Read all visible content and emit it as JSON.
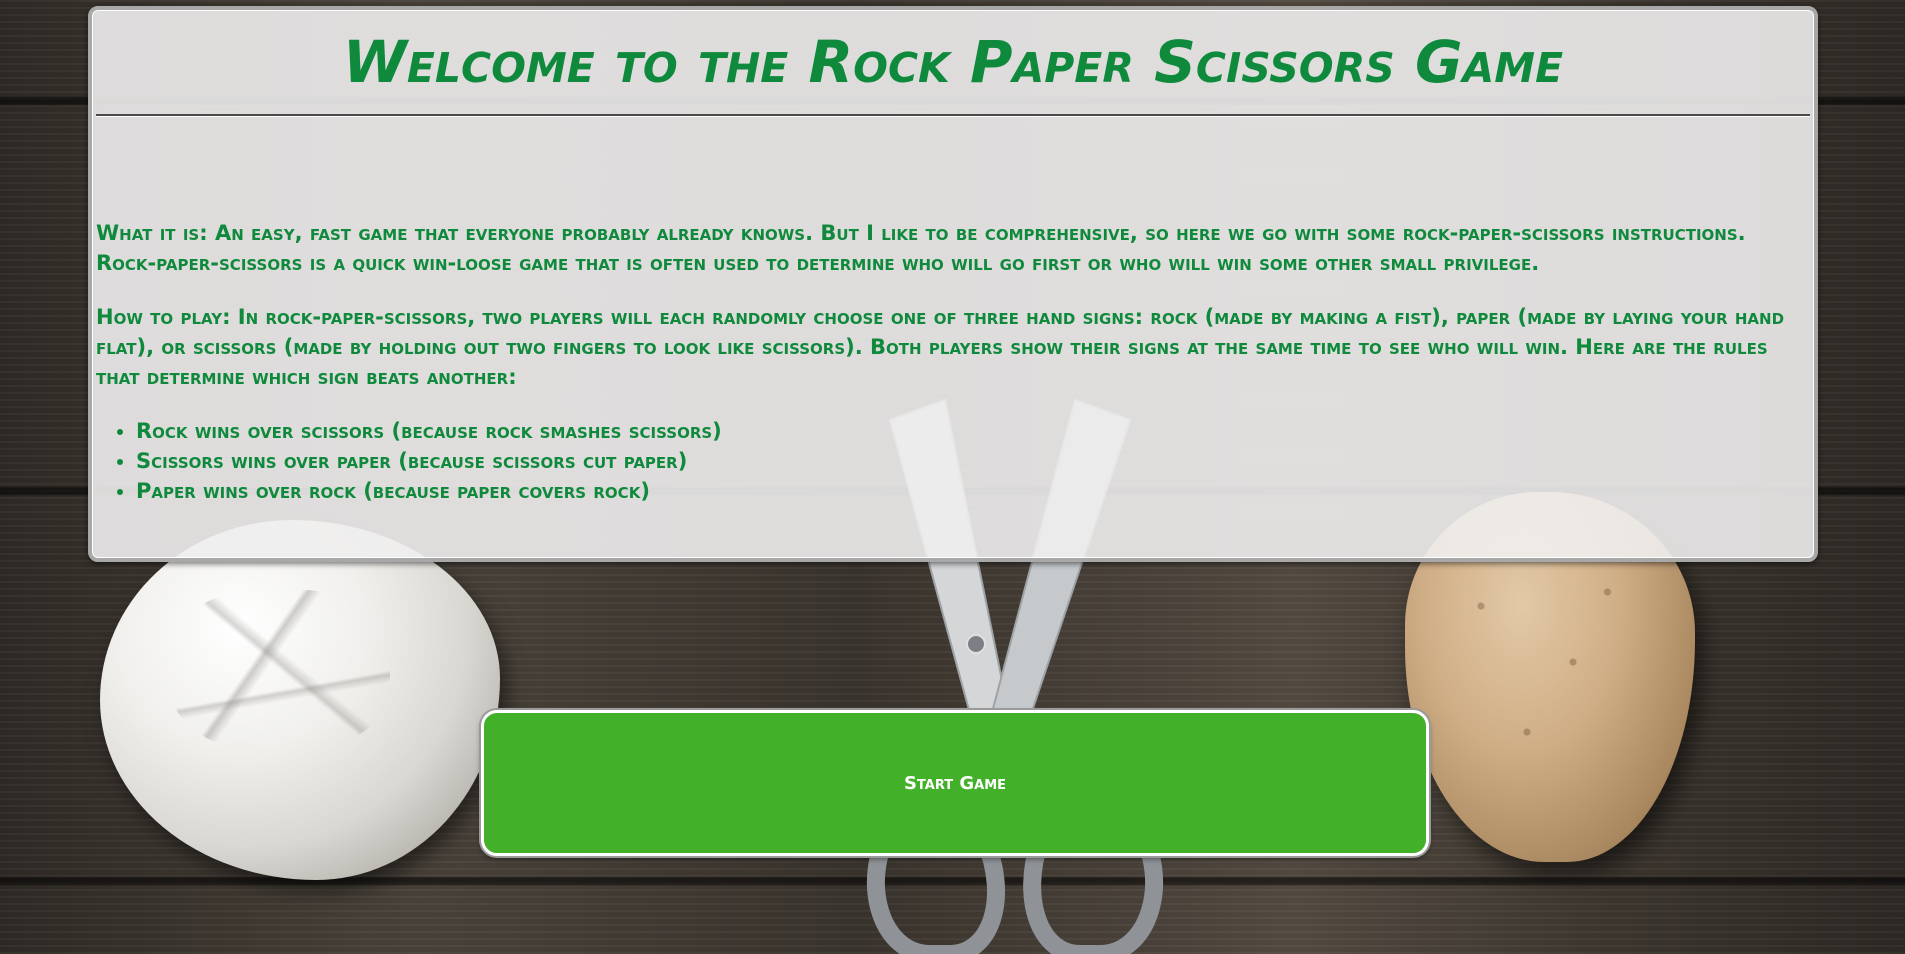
{
  "header": {
    "title": "Welcome to the Rock Paper Scissors Game"
  },
  "intro": {
    "what_label": "What it is:",
    "what_text": "An easy, fast game that everyone probably already knows. But I like to be comprehensive, so here we go with some rock-paper-scissors instructions. Rock-paper-scissors is a quick win-loose game that is often used to determine who will go first or who will win some other small privilege.",
    "how_label": "How to play:",
    "how_text": "In rock-paper-scissors, two players will each randomly choose one of three hand signs: rock (made by making a fist), paper (made by laying your hand flat), or scissors (made by holding out two fingers to look like scissors). Both players show their signs at the same time to see who will win. Here are the rules that determine which sign beats another:",
    "rules": [
      "Rock wins over scissors (because rock smashes scissors)",
      "Scissors wins over paper (because scissors cut paper)",
      "Paper wins over rock (because paper covers rock)"
    ]
  },
  "actions": {
    "start_label": "Start Game"
  },
  "colors": {
    "text_green": "#0f8a3c",
    "button_green": "#43b02a",
    "card_bg": "#f0eeee"
  },
  "decor": {
    "paper": "crumpled-paper-image",
    "rock": "rock-image",
    "scissors": "scissors-image"
  }
}
